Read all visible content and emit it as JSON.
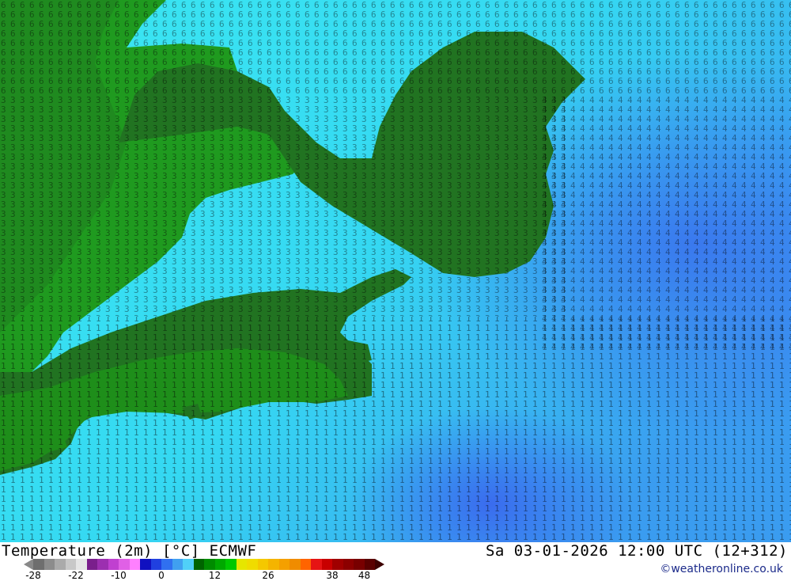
{
  "map": {
    "description_region": "East Asia temperature field",
    "colors": {
      "sea_cold": "#3be8f2",
      "sea_mid": "#2ec8f0",
      "sea_deep": "#3a7cf0",
      "land_dark": "#217321",
      "land_mid": "#1f8a1f",
      "land_light": "#20a61a",
      "digits": "#000000"
    }
  },
  "footer": {
    "title_left": "Temperature (2m) [°C] ECMWF",
    "title_right": "Sa 03-01-2026 12:00 UTC (12+312)",
    "credit": "©weatheronline.co.uk",
    "legend": {
      "colors": [
        "#6e6e6e",
        "#8c8c8c",
        "#aaaaaa",
        "#c8c8c8",
        "#e6e6e6",
        "#7a1f8c",
        "#9c2fb0",
        "#c040d0",
        "#e060e6",
        "#ff80ff",
        "#1010c0",
        "#2040e0",
        "#3070f0",
        "#40a0f0",
        "#50d0f8",
        "#006400",
        "#008c00",
        "#00a800",
        "#00c800",
        "#e6e600",
        "#f0dc00",
        "#f5c800",
        "#f5b400",
        "#f5a000",
        "#f08c00",
        "#ff6400",
        "#e61414",
        "#c80000",
        "#a00000",
        "#8c0000",
        "#780000",
        "#5a0000"
      ],
      "arrow_left": "#888888",
      "arrow_right": "#3c0000",
      "ticks": [
        "-28",
        "-22",
        "-10",
        "0",
        "12",
        "26",
        "38",
        "48"
      ]
    }
  }
}
